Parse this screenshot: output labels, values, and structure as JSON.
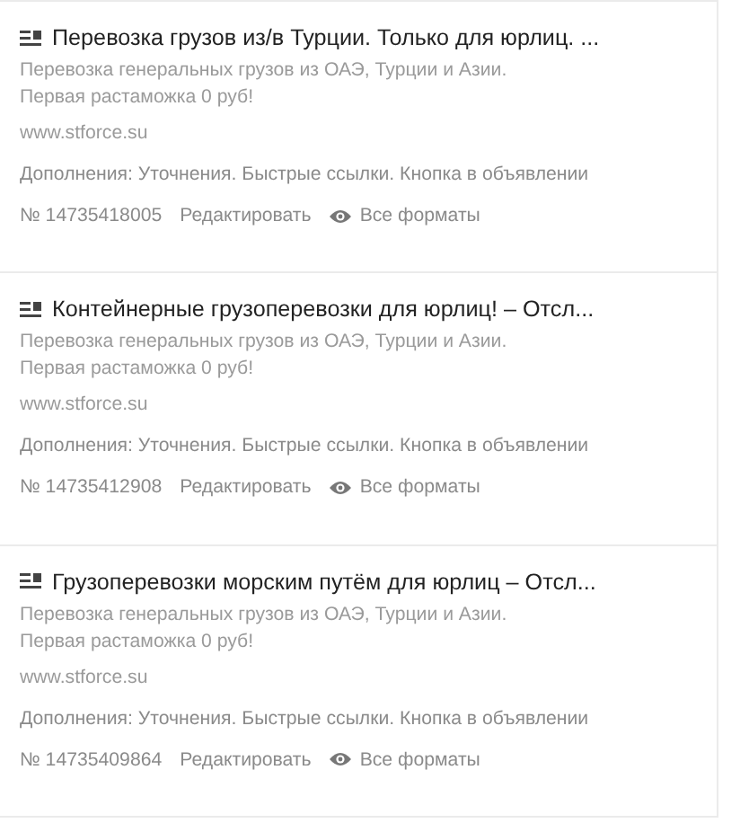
{
  "ads": [
    {
      "title": "Перевозка грузов из/в Турции. Только для юрлиц. ...",
      "description": [
        "Перевозка генеральных грузов из ОАЭ, Турции и Азии.",
        "Первая растаможка 0 руб!"
      ],
      "url": "www.stforce.su",
      "extras": "Дополнения: Уточнения. Быстрые ссылки. Кнопка в объявлении",
      "number": "№ 14735418005",
      "edit_link": "Редактировать",
      "formats_link": "Все форматы"
    },
    {
      "title": "Контейнерные грузоперевозки для юрлиц! – Отсл...",
      "description": [
        "Перевозка генеральных грузов из ОАЭ, Турции и Азии.",
        "Первая растаможка 0 руб!"
      ],
      "url": "www.stforce.su",
      "extras": "Дополнения: Уточнения. Быстрые ссылки. Кнопка в объявлении",
      "number": "№ 14735412908",
      "edit_link": "Редактировать",
      "formats_link": "Все форматы"
    },
    {
      "title": "Грузоперевозки морским путём для юрлиц – Отсл...",
      "description": [
        "Перевозка генеральных грузов из ОАЭ, Турции и Азии.",
        "Первая растаможка 0 руб!"
      ],
      "url": "www.stforce.su",
      "extras": "Дополнения: Уточнения. Быстрые ссылки. Кнопка в объявлении",
      "number": "№ 14735409864",
      "edit_link": "Редактировать",
      "formats_link": "Все форматы"
    }
  ]
}
